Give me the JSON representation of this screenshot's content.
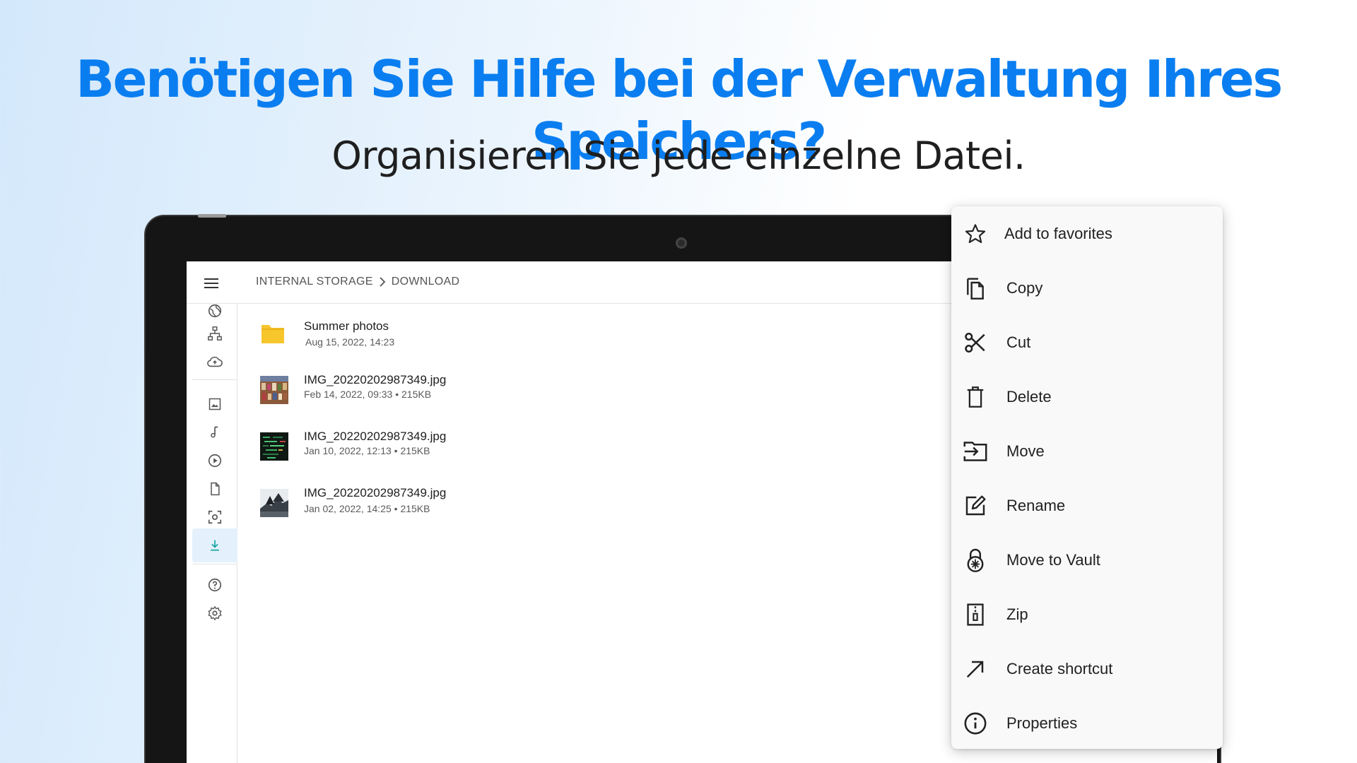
{
  "headline": "Benötigen Sie Hilfe bei der Verwaltung Ihres Speichers?",
  "subline": "Organisieren Sie jede einzelne Datei.",
  "colors": {
    "accent": "#0a7ef0",
    "folder": "#f7c52c",
    "active_rail": "#12a4a0"
  },
  "appbar": {
    "menu_icon": "hamburger-menu-icon",
    "breadcrumb": [
      "INTERNAL STORAGE",
      "DOWNLOAD"
    ]
  },
  "rail": {
    "items": [
      {
        "icon": "globe-icon"
      },
      {
        "icon": "network-icon"
      },
      {
        "icon": "cloud-upload-icon"
      },
      {
        "icon": "image-icon"
      },
      {
        "icon": "music-note-icon"
      },
      {
        "icon": "play-circle-icon"
      },
      {
        "icon": "document-icon"
      },
      {
        "icon": "screenshot-icon"
      },
      {
        "icon": "download-icon",
        "active": true
      },
      {
        "icon": "help-circle-icon"
      },
      {
        "icon": "settings-icon"
      }
    ]
  },
  "files": [
    {
      "name": "Summer photos",
      "meta": "Aug 15, 2022, 14:23",
      "type": "folder"
    },
    {
      "name": "IMG_20220202987349.jpg",
      "meta": "Feb 14, 2022, 09:33  •  215KB",
      "type": "image"
    },
    {
      "name": "IMG_20220202987349.jpg",
      "meta": "Jan 10, 2022, 12:13  •  215KB",
      "type": "image"
    },
    {
      "name": "IMG_20220202987349.jpg",
      "meta": "Jan 02, 2022, 14:25  •  215KB",
      "type": "image"
    }
  ],
  "context_menu": [
    {
      "label": "Add to favorites",
      "icon": "star-icon"
    },
    {
      "label": "Copy",
      "icon": "copy-icon"
    },
    {
      "label": "Cut",
      "icon": "scissors-icon"
    },
    {
      "label": "Delete",
      "icon": "trash-icon"
    },
    {
      "label": "Move",
      "icon": "move-icon"
    },
    {
      "label": "Rename",
      "icon": "rename-icon"
    },
    {
      "label": "Move to Vault",
      "icon": "vault-lock-icon"
    },
    {
      "label": "Zip",
      "icon": "zip-icon"
    },
    {
      "label": "Create shortcut",
      "icon": "arrow-up-right-icon"
    },
    {
      "label": "Properties",
      "icon": "info-icon"
    }
  ]
}
